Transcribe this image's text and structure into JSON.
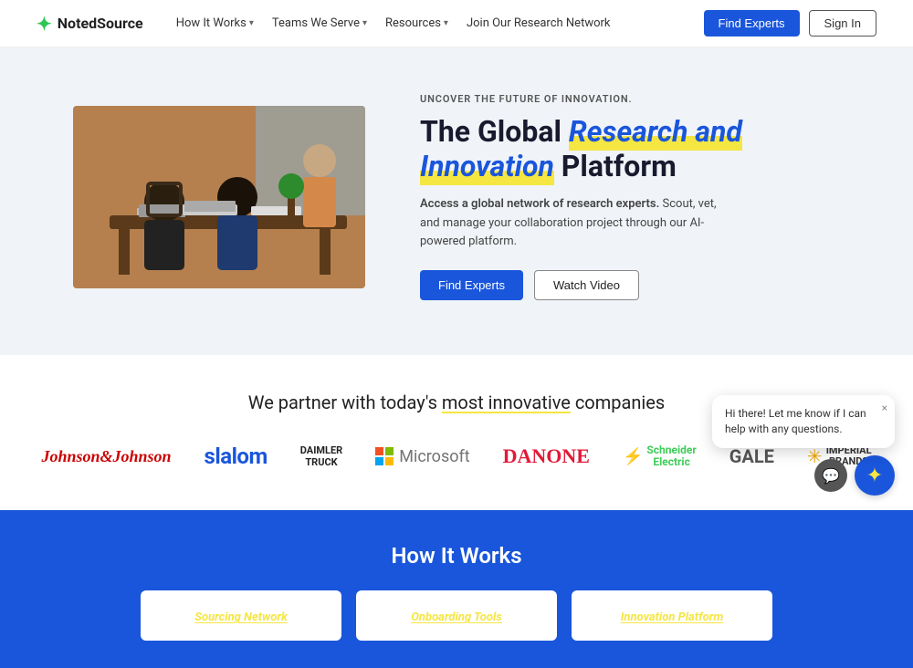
{
  "nav": {
    "logo_text": "NotedSource",
    "links": [
      {
        "label": "How It Works",
        "has_chevron": true
      },
      {
        "label": "Teams We Serve",
        "has_chevron": true
      },
      {
        "label": "Resources",
        "has_chevron": true
      },
      {
        "label": "Join Our Research Network",
        "has_chevron": false
      }
    ],
    "btn_find": "Find Experts",
    "btn_signin": "Sign In"
  },
  "hero": {
    "eyebrow": "UNCOVER THE FUTURE OF INNOVATION.",
    "title_pre": "The Global ",
    "title_highlight": "Research and Innovation",
    "title_post": " Platform",
    "subtitle_intro": "Access a global network of research experts.",
    "subtitle_rest": " Scout, vet, and manage your collaboration project through our AI-powered platform.",
    "btn_find": "Find Experts",
    "btn_watch": "Watch Video"
  },
  "partners": {
    "title_pre": "We partner with today's ",
    "title_highlight": "most innovative",
    "title_post": " companies",
    "logos": [
      {
        "name": "Johnson & Johnson",
        "type": "jj"
      },
      {
        "name": "slalom",
        "type": "slalom"
      },
      {
        "name": "Daimler Truck",
        "type": "daimler"
      },
      {
        "name": "Microsoft",
        "type": "microsoft"
      },
      {
        "name": "Danone",
        "type": "danone"
      },
      {
        "name": "Schneider Electric",
        "type": "schneider"
      },
      {
        "name": "GALE",
        "type": "gale"
      },
      {
        "name": "Imperial Brands",
        "type": "imperial"
      }
    ]
  },
  "how_it_works": {
    "title": "How It Works",
    "cards": [
      {
        "label": "Sourcing Network"
      },
      {
        "label": "Onboarding Tools"
      },
      {
        "label": "Innovation Platform"
      }
    ]
  },
  "chat": {
    "message": "Hi there! Let me know if I can help with any questions.",
    "close_label": "×"
  }
}
